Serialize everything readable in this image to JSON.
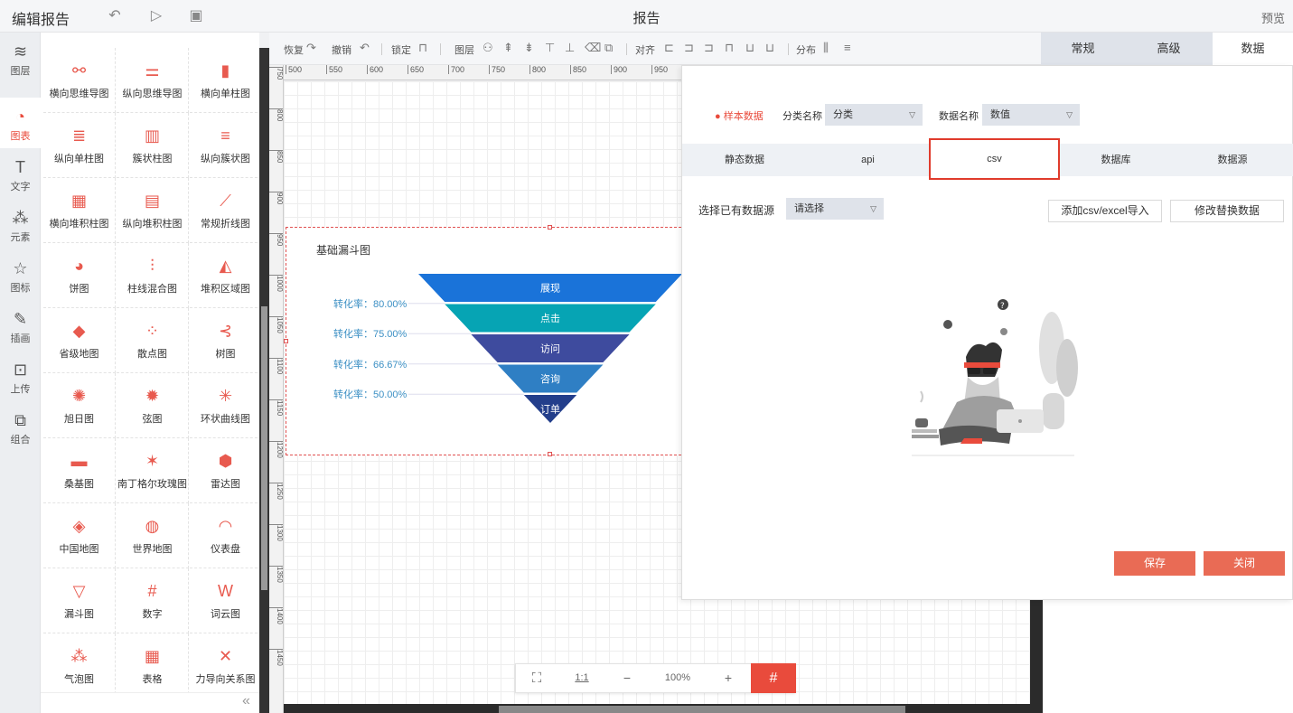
{
  "topbar": {
    "title": "编辑报告",
    "center_title": "报告",
    "preview": "预览"
  },
  "rail": [
    {
      "label": "图层",
      "icon": "layers-icon",
      "active": false
    },
    {
      "label": "图表",
      "icon": "chart-icon",
      "active": true
    },
    {
      "label": "文字",
      "icon": "text-icon",
      "active": false
    },
    {
      "label": "元素",
      "icon": "element-icon",
      "active": false
    },
    {
      "label": "图标",
      "icon": "star-icon",
      "active": false
    },
    {
      "label": "插画",
      "icon": "palette-icon",
      "active": false
    },
    {
      "label": "上传",
      "icon": "upload-image-icon",
      "active": false
    },
    {
      "label": "组合",
      "icon": "group-icon",
      "active": false
    }
  ],
  "library": [
    "横向思维导图",
    "纵向思维导图",
    "横向单柱图",
    "纵向单柱图",
    "簇状柱图",
    "纵向簇状图",
    "横向堆积柱图",
    "纵向堆积柱图",
    "常规折线图",
    "饼图",
    "柱线混合图",
    "堆积区域图",
    "省级地图",
    "散点图",
    "树图",
    "旭日图",
    "弦图",
    "环状曲线图",
    "桑基图",
    "南丁格尔玫瑰图",
    "雷达图",
    "中国地图",
    "世界地图",
    "仪表盘",
    "漏斗图",
    "数字",
    "词云图",
    "气泡图",
    "表格",
    "力导向关系图"
  ],
  "toolbar": {
    "redo": "恢复",
    "undo": "撤销",
    "lock": "锁定",
    "layer": "图层",
    "align": "对齐",
    "distribute": "分布"
  },
  "ruler": {
    "top_ticks": [
      "500",
      "550",
      "600",
      "650",
      "700",
      "750",
      "800",
      "850",
      "900",
      "950"
    ],
    "left_ticks": [
      "750",
      "800",
      "850",
      "900",
      "950",
      "1000",
      "1050",
      "1100",
      "1150",
      "1200",
      "1250",
      "1300",
      "1350",
      "1400",
      "1450"
    ]
  },
  "widget": {
    "title": "基础漏斗图",
    "stages": [
      "展现",
      "点击",
      "访问",
      "咨询",
      "订单"
    ],
    "conversion_rates": [
      "转化率：80.00%",
      "转化率：75.00%",
      "转化率：66.67%",
      "转化率：50.00%"
    ],
    "colors": [
      "#1a73d9",
      "#06a4b4",
      "#3e4b9e",
      "#2f7fc4",
      "#233e8b"
    ]
  },
  "zoombar": {
    "ratio": "1:1",
    "minus": "−",
    "zoom": "100%",
    "plus": "+"
  },
  "property_tabs": [
    {
      "label": "常规",
      "active": false
    },
    {
      "label": "高级",
      "active": false
    },
    {
      "label": "数据",
      "active": true
    }
  ],
  "dialog": {
    "sample_data": "样本数据",
    "category_label": "分类名称",
    "category_value": "分类",
    "value_label": "数据名称",
    "value_value": "数值",
    "source_tabs": [
      {
        "label": "静态数据",
        "active": false
      },
      {
        "label": "api",
        "active": false
      },
      {
        "label": "csv",
        "active": true
      },
      {
        "label": "数据库",
        "active": false
      },
      {
        "label": "数据源",
        "active": false
      }
    ],
    "existing_source_label": "选择已有数据源",
    "existing_source_value": "请选择",
    "add_csv": "添加csv/excel导入",
    "replace_data": "修改替换数据",
    "save": "保存",
    "close": "关闭"
  }
}
